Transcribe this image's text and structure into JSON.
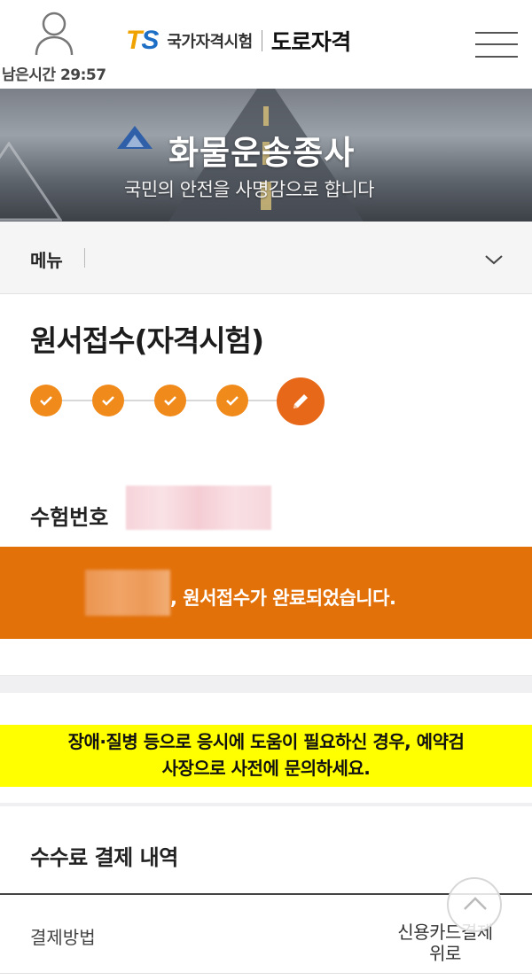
{
  "header": {
    "timer_text": "남은시간 29:57",
    "logo_t": "T",
    "logo_s": "S",
    "org_name": "국가자격시험",
    "site_title": "도로자격"
  },
  "banner": {
    "title": "화물운송종사",
    "subtitle": "국민의 안전을 사명감으로 합니다"
  },
  "menu": {
    "label": "메뉴"
  },
  "page": {
    "title": "원서접수(자격시험)",
    "steps_total": 5,
    "steps_completed": 4
  },
  "exam": {
    "number_label": "수험번호"
  },
  "completion": {
    "message": ", 원서접수가 완료되었습니다."
  },
  "notice": {
    "line1": "장애·질병 등으로 응시에 도움이 필요하신 경우, 예약검",
    "line2": "사장으로 사전에 문의하세요."
  },
  "fee": {
    "section_title": "수수료 결제 내역",
    "method_label": "결제방법",
    "method_value": "신용카드결제",
    "method_value_cont": "위로"
  },
  "colors": {
    "accent_orange": "#e2710a",
    "step_orange": "#f08a1a",
    "notice_yellow": "#ffff00",
    "logo_orange": "#f0a300",
    "logo_blue": "#1d6fc6"
  },
  "icons": {
    "user": "user-icon",
    "menu": "hamburger-icon",
    "chevron": "chevron-down-icon",
    "check": "check-icon",
    "pencil": "pencil-icon",
    "scroll_top": "chevron-up-icon"
  }
}
